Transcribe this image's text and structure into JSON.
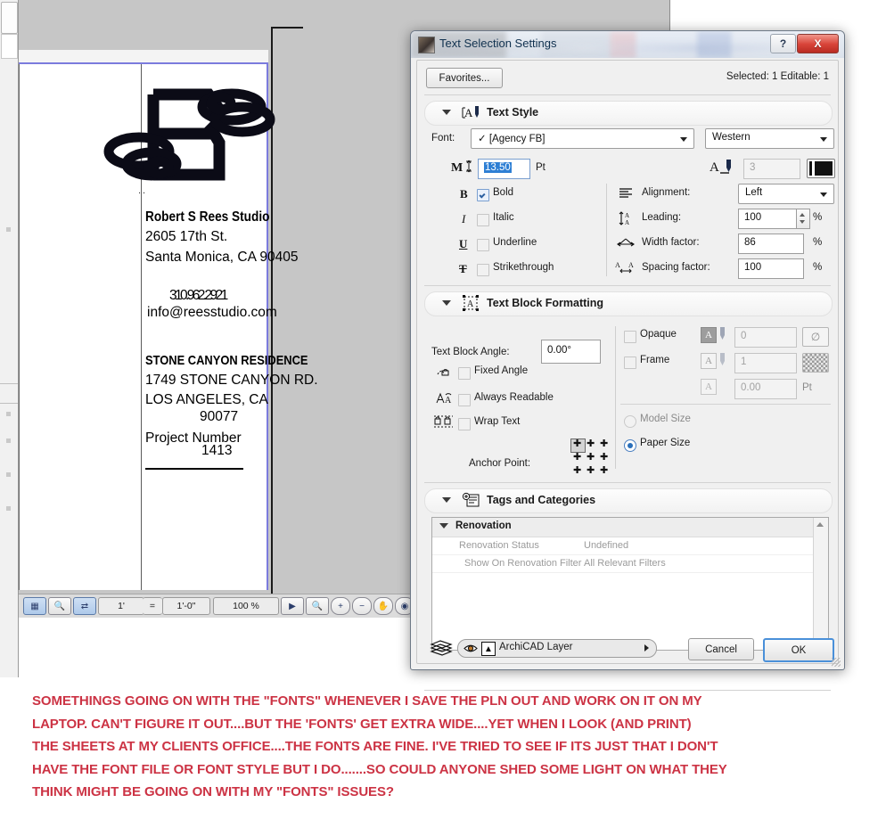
{
  "dialog": {
    "title": "Text Selection Settings",
    "icon": "archicad-text-icon",
    "help_label": "?",
    "close_label": "X",
    "favorites_label": "Favorites...",
    "selection_status": "Selected: 1 Editable: 1",
    "sections": {
      "text_style": {
        "title": "Text Style",
        "font_label": "Font:",
        "font_value": "✓ [Agency FB]",
        "script_value": "Western",
        "size_value": "13.50",
        "size_unit": "Pt",
        "pen_value": "3",
        "pen_color": "#111111",
        "styles": [
          {
            "glyph": "B",
            "label": "Bold",
            "checked": true
          },
          {
            "glyph": "I",
            "label": "Italic",
            "checked": false
          },
          {
            "glyph": "U",
            "label": "Underline",
            "checked": false
          },
          {
            "glyph": "T",
            "label": "Strikethrough",
            "checked": false
          }
        ],
        "alignment_label": "Alignment:",
        "alignment_value": "Left",
        "leading_label": "Leading:",
        "leading_value": "100",
        "leading_unit": "%",
        "width_label": "Width factor:",
        "width_value": "86",
        "width_unit": "%",
        "spacing_label": "Spacing factor:",
        "spacing_value": "100",
        "spacing_unit": "%"
      },
      "text_block": {
        "title": "Text Block Formatting",
        "angle_label": "Text Block Angle:",
        "angle_value": "0.00°",
        "fixed_angle_label": "Fixed Angle",
        "always_readable_label": "Always Readable",
        "wrap_text_label": "Wrap Text",
        "anchor_label": "Anchor Point:",
        "opaque_label": "Opaque",
        "opaque_value": "0",
        "frame_label": "Frame",
        "frame_value": "1",
        "offset_value": "0.00",
        "offset_unit": "Pt",
        "model_size_label": "Model Size",
        "paper_size_label": "Paper Size",
        "size_mode": "Paper Size"
      },
      "tags": {
        "title": "Tags and Categories",
        "group_label": "Renovation",
        "rows": [
          {
            "key": "Renovation Status",
            "value": "Undefined"
          },
          {
            "key": "Show On Renovation Filter",
            "value": "All Relevant Filters"
          }
        ]
      }
    },
    "footer": {
      "layer_value": "ArchiCAD Layer",
      "cancel_label": "Cancel",
      "ok_label": "OK"
    }
  },
  "cad": {
    "drawing": {
      "logo_alt": "rs-monogram-logo",
      "block1": [
        "Robert S Rees Studio",
        "2605 17th St.",
        "Santa Monica, CA 90405",
        "310.962.2921",
        "info@reesstudio.com"
      ],
      "block2": [
        "STONE CANYON RESIDENCE",
        "1749 STONE CANYON RD.",
        "LOS ANGELES, CA",
        "90077",
        "Project Number",
        "1413"
      ],
      "small_mark": ".."
    },
    "status_bar": {
      "scale_left": "1'",
      "scale_eq": "=",
      "scale_right": "1'-0\"",
      "zoom_value": "100 %",
      "buttons": [
        "dimension-icon",
        "zoom-preview-icon",
        "fit-icon",
        "next-arrow-icon",
        "zoom-range-icon",
        "zoom-in-icon",
        "zoom-out-icon",
        "pan-icon",
        "fit-in-window-icon",
        "zoom-previous-icon",
        "zoom-next-icon"
      ]
    }
  },
  "caption": {
    "lines": [
      "SOMETHINGS GOING ON WITH THE \"FONTS\" WHENEVER I SAVE THE PLN OUT AND WORK ON IT ON MY",
      "LAPTOP. CAN'T FIGURE IT OUT....BUT THE 'FONTS' GET EXTRA WIDE....YET WHEN I LOOK (AND PRINT)",
      "THE SHEETS AT MY CLIENTS OFFICE....THE FONTS ARE FINE. I'VE TRIED TO SEE IF ITS JUST THAT I DON'T",
      "HAVE THE FONT FILE OR FONT STYLE BUT I DO.......SO COULD ANYONE SHED SOME LIGHT ON WHAT THEY",
      "THINK MIGHT BE GOING ON WITH MY \"FONTS\" ISSUES?"
    ],
    "color": "#cc3344"
  }
}
